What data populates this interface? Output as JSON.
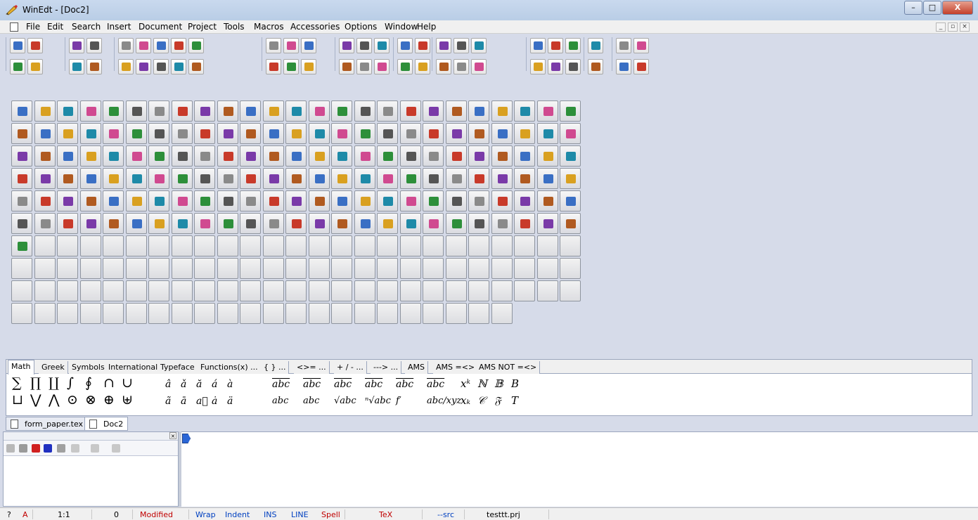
{
  "window": {
    "title": "WinEdt - [Doc2]",
    "btn_minimize": "–",
    "btn_maximize": "□",
    "btn_close": "X"
  },
  "menu": {
    "items": [
      "File",
      "Edit",
      "Search",
      "Insert",
      "Document",
      "Project",
      "Tools",
      "Macros",
      "Accessories",
      "Options",
      "Window",
      "Help"
    ],
    "mdi_min": "_",
    "mdi_restore": "▫",
    "mdi_close": "×"
  },
  "palette": {
    "tabs": [
      "Math",
      "Greek",
      "Symbols",
      "International",
      "Typeface",
      "Functions(x) ...",
      "{ } ...",
      "<>= ...",
      "+ / - ...",
      "---> ...",
      "AMS",
      "AMS =<>",
      "AMS NOT =<>"
    ],
    "active_tab": "Math",
    "big_row1": [
      "∑",
      "∏",
      "∐",
      "∫",
      "∮",
      "∩",
      "∪"
    ],
    "big_row2": [
      "⊔",
      "⋁",
      "⋀",
      "⊙",
      "⊗",
      "⊕",
      "⊎"
    ],
    "acc_row1": [
      "â",
      "ǎ",
      "ă",
      "á",
      "à"
    ],
    "acc_row2": [
      "ã",
      "ā",
      "a⃗",
      "ȧ",
      "ä"
    ],
    "wide_row1": [
      "abc",
      "abc",
      "abc",
      "abc",
      "abc",
      "abc"
    ],
    "wide_row2": [
      "abc",
      "abc",
      "√abc",
      "ⁿ√abc",
      "f′",
      "abc/xyz"
    ],
    "right_row1": [
      "xᵏ",
      "ℕ",
      "𝔹",
      "B"
    ],
    "right_row2": [
      "xₖ",
      "𝒞",
      "𝔉",
      "T"
    ]
  },
  "doc_tabs": [
    {
      "label": "form_paper.tex",
      "active": false
    },
    {
      "label": "Doc2",
      "active": true
    }
  ],
  "status_bar": {
    "help": "?",
    "a": "A",
    "position": "1:1",
    "count": "0",
    "modified": "Modified",
    "wrap": "Wrap",
    "indent": "Indent",
    "ins": "INS",
    "line": "LINE",
    "spell": "Spell",
    "mode": "TeX",
    "src": "--src",
    "project": "testtt.prj"
  }
}
